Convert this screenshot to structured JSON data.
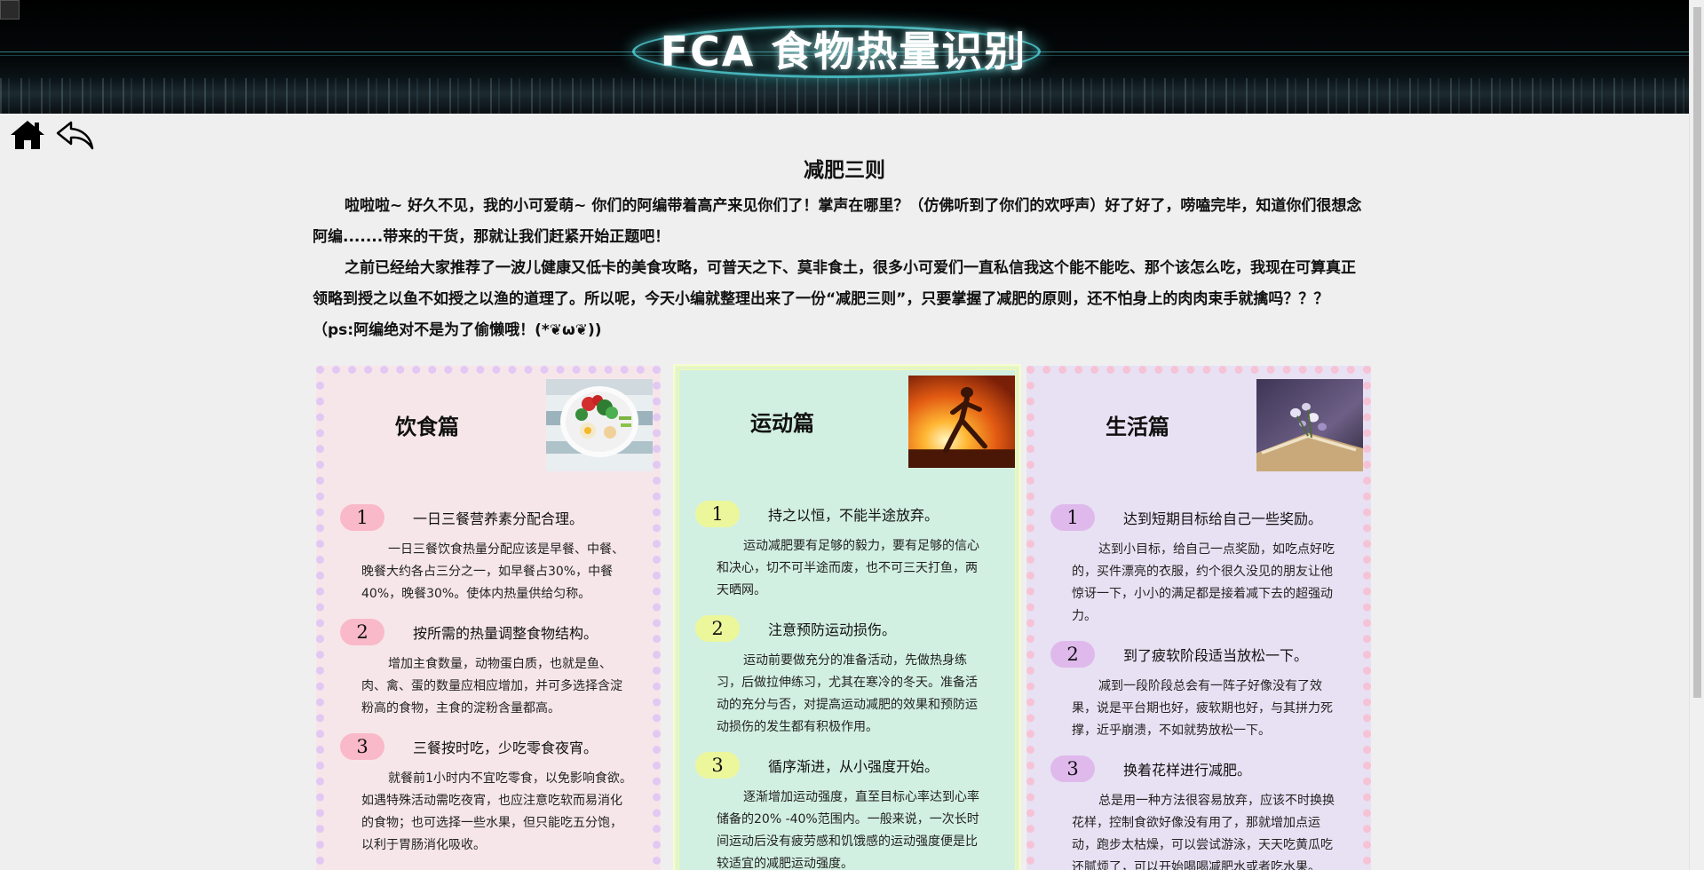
{
  "banner": {
    "title": "FCA 食物热量识别"
  },
  "nav": {
    "home_icon": "home-icon",
    "back_icon": "back-arrow-icon"
  },
  "article": {
    "title": "减肥三则",
    "paragraphs": [
      "啦啦啦~ 好久不见，我的小可爱萌~ 你们的阿编带着高产来见你们了！掌声在哪里？（仿佛听到了你们的欢呼声）好了好了，唠嗑完毕，知道你们很想念阿编.......带来的干货，那就让我们赶紧开始正题吧！",
      "之前已经给大家推荐了一波儿健康又低卡的美食攻略，可普天之下、莫非食土，很多小可爱们一直私信我这个能不能吃、那个该怎么吃，我现在可算真正领略到授之以鱼不如授之以渔的道理了。所以呢，今天小编就整理出来了一份“减肥三则”，只要掌握了减肥的原则，还不怕身上的肉肉束手就擒吗？？？　（ps:阿编绝对不是为了偷懒哦！(*❦ω❦))"
    ]
  },
  "columns": [
    {
      "title": "饮食篇",
      "image": "salad-plate-image",
      "items": [
        {
          "num": "1",
          "heading": "一日三餐营养素分配合理。",
          "body": "一日三餐饮食热量分配应该是早餐、中餐、晚餐大约各占三分之一，如早餐占30%，中餐40%，晚餐30%。使体内热量供给匀称。"
        },
        {
          "num": "2",
          "heading": "按所需的热量调整食物结构。",
          "body": "增加主食数量，动物蛋白质，也就是鱼、肉、禽、蛋的数量应相应增加，并可多选择含淀粉高的食物，主食的淀粉含量都高。"
        },
        {
          "num": "3",
          "heading": "三餐按时吃，少吃零食夜宵。",
          "body": "就餐前1小时内不宜吃零食，以免影响食欲。如遇特殊活动需吃夜宵，也应注意吃软而易消化的食物；也可选择一些水果，但只能吃五分饱，以利于胃肠消化吸收。"
        }
      ]
    },
    {
      "title": "运动篇",
      "image": "running-woman-image",
      "items": [
        {
          "num": "1",
          "heading": "持之以恒，不能半途放弃。",
          "body": "运动减肥要有足够的毅力，要有足够的信心和决心，切不可半途而废，也不可三天打鱼，两天晒网。"
        },
        {
          "num": "2",
          "heading": "注意预防运动损伤。",
          "body": "运动前要做充分的准备活动，先做热身练习，后做拉伸练习，尤其在寒冷的冬天。准备活动的充分与否，对提高运动减肥的效果和预防运动损伤的发生都有积极作用。"
        },
        {
          "num": "3",
          "heading": "循序渐进，从小强度开始。",
          "body": "逐渐增加运动强度，直至目标心率达到心率储备的20% -40%范围内。一般来说，一次长时间运动后没有疲劳感和饥饿感的运动强度便是比较适宜的减肥运动强度。"
        }
      ]
    },
    {
      "title": "生活篇",
      "image": "book-and-flowers-image",
      "items": [
        {
          "num": "1",
          "heading": "达到短期目标给自己一些奖励。",
          "body": "达到小目标，给自己一点奖励，如吃点好吃的，买件漂亮的衣服，约个很久没见的朋友让他惊讶一下，小小的满足都是接着减下去的超强动力。"
        },
        {
          "num": "2",
          "heading": "到了疲软阶段适当放松一下。",
          "body": "减到一段阶段总会有一阵子好像没有了效果，说是平台期也好，疲软期也好，与其拼力死撑，近乎崩溃，不如就势放松一下。"
        },
        {
          "num": "3",
          "heading": "换着花样进行减肥。",
          "body": "总是用一种方法很容易放弃，应该不时换换花样，控制食欲好像没有用了，那就增加点运动，跑步太枯燥，可以尝试游泳，天天吃黄瓜吃还腻烦了，可以开始喝喝减肥水或者吃水果。"
        }
      ]
    }
  ]
}
